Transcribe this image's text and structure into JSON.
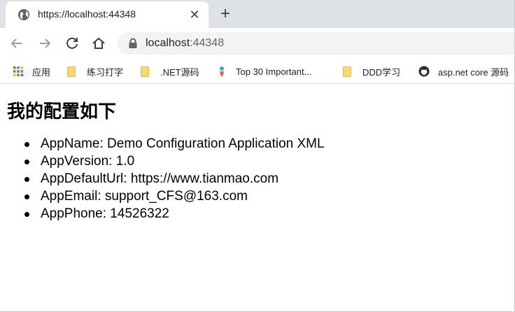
{
  "browser": {
    "tab": {
      "title": "https://localhost:44348",
      "close_glyph": "✕",
      "favicon": "globe-icon"
    },
    "new_tab_glyph": "+",
    "toolbar": {
      "back_icon": "back-arrow-icon",
      "forward_icon": "forward-arrow-icon",
      "reload_icon": "reload-icon",
      "home_icon": "home-icon"
    },
    "address_bar": {
      "host": "localhost",
      "port": ":44348",
      "security_icon": "lock-icon"
    },
    "bookmarks": [
      {
        "label": "应用",
        "icon": "apps-grid-icon"
      },
      {
        "label": "练习打字",
        "icon": "folder-icon"
      },
      {
        "label": ".NET源码",
        "icon": "folder-icon"
      },
      {
        "label": "Top 30 Important...",
        "icon": "site-favicon"
      },
      {
        "label": "DDD学习",
        "icon": "folder-icon"
      },
      {
        "label": "asp.net core 源码",
        "icon": "github-icon"
      }
    ]
  },
  "page": {
    "heading": "我的配置如下",
    "items": [
      {
        "text": "AppName: Demo Configuration Application XML"
      },
      {
        "text": "AppVersion: 1.0"
      },
      {
        "text": "AppDefaultUrl: https://www.tianmao.com"
      },
      {
        "text": "AppEmail: support_CFS@163.com"
      },
      {
        "text": "AppPhone: 14526322"
      }
    ]
  },
  "colors": {
    "tabstrip_bg": "#dee1e6",
    "omnibox_bg": "#f1f3f4",
    "folder": "#f9d772",
    "text": "#202124"
  }
}
